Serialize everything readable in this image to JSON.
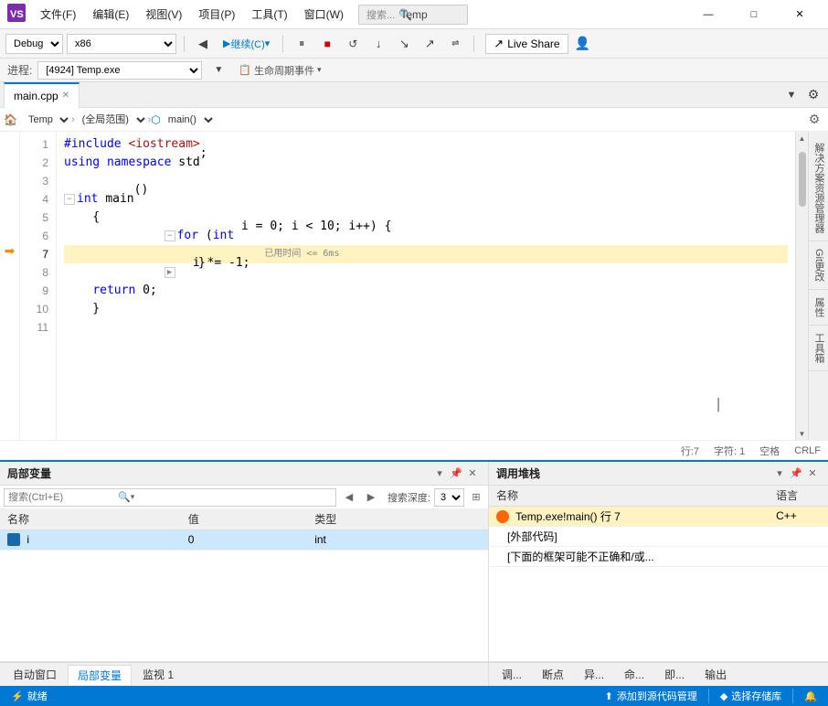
{
  "titlebar": {
    "logo_text": "VS",
    "menus": [
      "文件(F)",
      "编辑(E)",
      "视图(V)",
      "项目(P)",
      "工具(T)",
      "窗口(W)"
    ],
    "search_placeholder": "搜索...",
    "title": "Temp",
    "min": "—",
    "max": "□",
    "close": "✕"
  },
  "toolbar": {
    "config": "Debug",
    "platform": "x86",
    "continue_btn": "▶ 继续(C) ▾",
    "live_share": "Live Share"
  },
  "process_bar": {
    "label": "进程:",
    "process": "[4924] Temp.exe",
    "lifecycle": "生命周期事件"
  },
  "editor": {
    "tab_name": "main.cpp",
    "breadcrumb_left": "Temp",
    "breadcrumb_middle": "(全局范围)",
    "breadcrumb_right": "main()",
    "status": {
      "line": "行:7",
      "col": "字符: 1",
      "spaces": "空格",
      "encoding": "CRLF"
    },
    "lines": [
      {
        "num": 1,
        "content": "#include <iostream>",
        "type": "normal"
      },
      {
        "num": 2,
        "content": "using namespace std;",
        "type": "normal"
      },
      {
        "num": 3,
        "content": "",
        "type": "normal"
      },
      {
        "num": 4,
        "content": "int main()",
        "type": "normal",
        "fold": true
      },
      {
        "num": 5,
        "content": "{",
        "type": "normal",
        "indent": 1
      },
      {
        "num": 6,
        "content": "    for (int i = 0; i < 10; i++) {",
        "type": "normal",
        "indent": 2,
        "fold": true
      },
      {
        "num": 7,
        "content": "        i *= -1;",
        "type": "highlighted",
        "indent": 3,
        "debug_hint": "已用时间 <= 6ms",
        "is_current": true
      },
      {
        "num": 8,
        "content": "    }",
        "type": "normal",
        "indent": 2,
        "fold_end": true
      },
      {
        "num": 9,
        "content": "    return 0;",
        "type": "normal",
        "indent": 2
      },
      {
        "num": 10,
        "content": "}",
        "type": "normal",
        "indent": 1
      },
      {
        "num": 11,
        "content": "",
        "type": "normal"
      }
    ]
  },
  "right_panel": {
    "items": [
      "解决方案资源管理器",
      "Git更改",
      "属性",
      "工具箱"
    ]
  },
  "locals_panel": {
    "title": "局部变量",
    "search_placeholder": "搜索(Ctrl+E)",
    "depth_label": "搜索深度:",
    "depth_value": "3",
    "columns": [
      "名称",
      "值",
      "类型"
    ],
    "variables": [
      {
        "name": "i",
        "value": "0",
        "type": "int",
        "selected": true
      }
    ]
  },
  "callstack_panel": {
    "title": "调用堆栈",
    "columns": [
      "名称",
      "语言"
    ],
    "frames": [
      {
        "name": "Temp.exe!main() 行 7",
        "lang": "C++",
        "active": true
      },
      {
        "name": "[外部代码]",
        "lang": "",
        "active": false
      },
      {
        "name": "[下面的框架可能不正确和/或...",
        "lang": "",
        "active": false
      }
    ]
  },
  "bottom_tabs": {
    "locals": [
      "自动窗口",
      "局部变量",
      "监视 1"
    ],
    "callstack": [
      "调...",
      "断点",
      "异...",
      "命...",
      "即...",
      "输出"
    ]
  },
  "statusbar": {
    "ready": "就绪",
    "source_control": "添加到源代码管理",
    "repo": "选择存储库",
    "bell": "🔔"
  }
}
